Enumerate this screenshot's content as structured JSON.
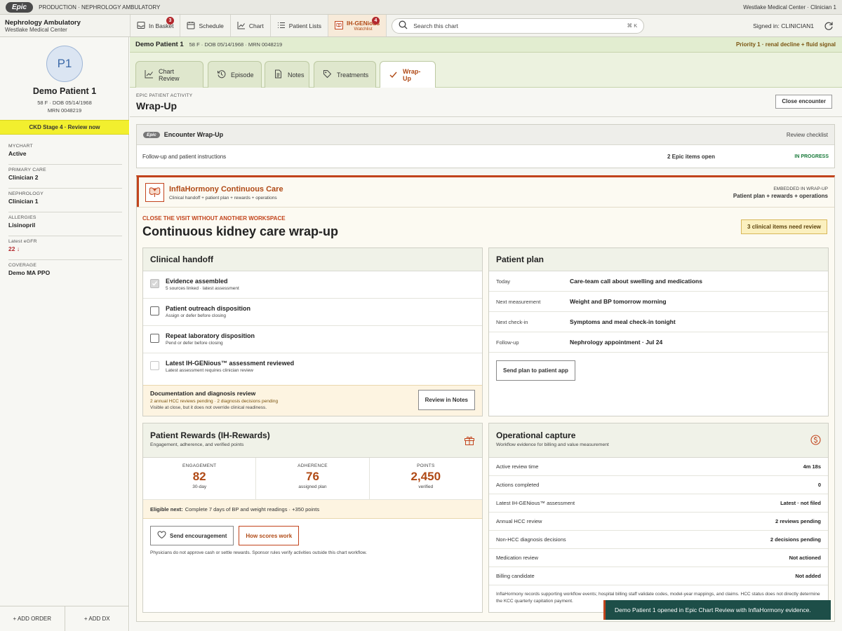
{
  "topbar": {
    "logo": "Epic",
    "env": "PRODUCTION · NEPHROLOGY AMBULATORY",
    "right": "Westlake Medical Center · Clinician 1"
  },
  "toolbar": {
    "dept_name": "Nephrology Ambulatory",
    "dept_site": "Westlake Medical Center",
    "in_basket": "In Basket",
    "in_basket_count": "3",
    "schedule": "Schedule",
    "chart": "Chart",
    "patient_lists": "Patient Lists",
    "ihg_title": "IH-GENious",
    "ihg_sub": "Watchlist",
    "ihg_count": "4",
    "search_placeholder": "Search this chart",
    "search_shortcut": "⌘ K",
    "signed_in": "Signed in: CLINICIAN1"
  },
  "sidebar": {
    "avatar": "P1",
    "name": "Demo Patient 1",
    "demo": "58 F · DOB 05/14/1968",
    "mrn": "MRN 0048219",
    "alert": "CKD Stage 4 · Review now",
    "fields": [
      {
        "label": "MYCHART",
        "value": "Active"
      },
      {
        "label": "PRIMARY CARE",
        "value": "Clinician 2"
      },
      {
        "label": "NEPHROLOGY",
        "value": "Clinician 1"
      },
      {
        "label": "ALLERGIES",
        "value": "Lisinopril"
      },
      {
        "label": "Latest eGFR",
        "value": "22 ↓"
      },
      {
        "label": "COVERAGE",
        "value": "Demo MA PPO"
      }
    ],
    "add_order": "+ ADD ORDER",
    "add_dx": "+ ADD DX"
  },
  "patient_bar": {
    "name": "Demo Patient 1",
    "details": "58 F · DOB 05/14/1968 · MRN 0048219",
    "priority": "Priority 1 · renal decline + fluid signal"
  },
  "tabs": [
    "Chart Review",
    "Episode",
    "Notes",
    "Treatments",
    "Wrap-Up"
  ],
  "page": {
    "eyebrow": "EPIC PATIENT ACTIVITY",
    "title": "Wrap-Up",
    "close": "Close encounter"
  },
  "encounter": {
    "badge": "Epic",
    "title": "Encounter Wrap-Up",
    "review": "Review checklist",
    "row": "Follow-up and patient instructions",
    "open": "2 Epic items open",
    "status": "IN PROGRESS"
  },
  "ih": {
    "title": "InflaHormony Continuous Care",
    "sub": "Clinical handoff + patient plan + rewards + operations",
    "embedded": "EMBEDDED IN WRAP-UP",
    "embedded_detail": "Patient plan + rewards + operations",
    "eyebrow": "CLOSE THE VISIT WITHOUT ANOTHER WORKSPACE",
    "heading": "Continuous kidney care wrap-up",
    "review_pill": "3 clinical items need review"
  },
  "handoff": {
    "title": "Clinical handoff",
    "items": [
      {
        "title": "Evidence assembled",
        "sub": "5 sources linked · latest assessment"
      },
      {
        "title": "Patient outreach disposition",
        "sub": "Assign or defer before closing"
      },
      {
        "title": "Repeat laboratory disposition",
        "sub": "Pend or defer before closing"
      },
      {
        "title": "Latest IH-GENious™ assessment reviewed",
        "sub": "Latest assessment requires clinician review"
      }
    ],
    "doc_title": "Documentation and diagnosis review",
    "doc_sub1": "2 annual HCC reviews pending · 2 diagnosis decisions pending",
    "doc_sub2": "Visible at close, but it does not override clinical readiness.",
    "doc_btn": "Review in Notes"
  },
  "plan": {
    "title": "Patient plan",
    "rows": [
      {
        "k": "Today",
        "v": "Care-team call about swelling and medications"
      },
      {
        "k": "Next measurement",
        "v": "Weight and BP tomorrow morning"
      },
      {
        "k": "Next check-in",
        "v": "Symptoms and meal check-in tonight"
      },
      {
        "k": "Follow-up",
        "v": "Nephrology appointment · Jul 24"
      }
    ],
    "send": "Send plan to patient app"
  },
  "rewards": {
    "title": "Patient Rewards (IH-Rewards)",
    "sub": "Engagement, adherence, and verified points",
    "metrics": [
      {
        "label": "ENGAGEMENT",
        "value": "82",
        "unit": "30-day"
      },
      {
        "label": "ADHERENCE",
        "value": "76",
        "unit": "assigned plan"
      },
      {
        "label": "POINTS",
        "value": "2,450",
        "unit": "verified"
      }
    ],
    "eligible_label": "Eligible next:",
    "eligible_text": "Complete 7 days of BP and weight readings · +350 points",
    "encourage": "Send encouragement",
    "how": "How scores work",
    "note": "Physicians do not approve cash or settle rewards. Sponsor rules verify activities outside this chart workflow."
  },
  "ops": {
    "title": "Operational capture",
    "sub": "Workflow evidence for billing and value measurement",
    "rows": [
      {
        "k": "Active review time",
        "v": "4m 18s"
      },
      {
        "k": "Actions completed",
        "v": "0"
      },
      {
        "k": "Latest IH-GENious™ assessment",
        "v": "Latest · not filed"
      },
      {
        "k": "Annual HCC review",
        "v": "2 reviews pending"
      },
      {
        "k": "Non-HCC diagnosis decisions",
        "v": "2 decisions pending"
      },
      {
        "k": "Medication review",
        "v": "Not actioned"
      },
      {
        "k": "Billing candidate",
        "v": "Not added"
      }
    ],
    "note": "InflaHormony records supporting workflow events; hospital billing staff validate codes, model-year mappings, and claims. HCC status does not directly determine the KCC quarterly capitation payment."
  },
  "toast": "Demo Patient 1 opened in Epic Chart Review with InflaHormony evidence."
}
